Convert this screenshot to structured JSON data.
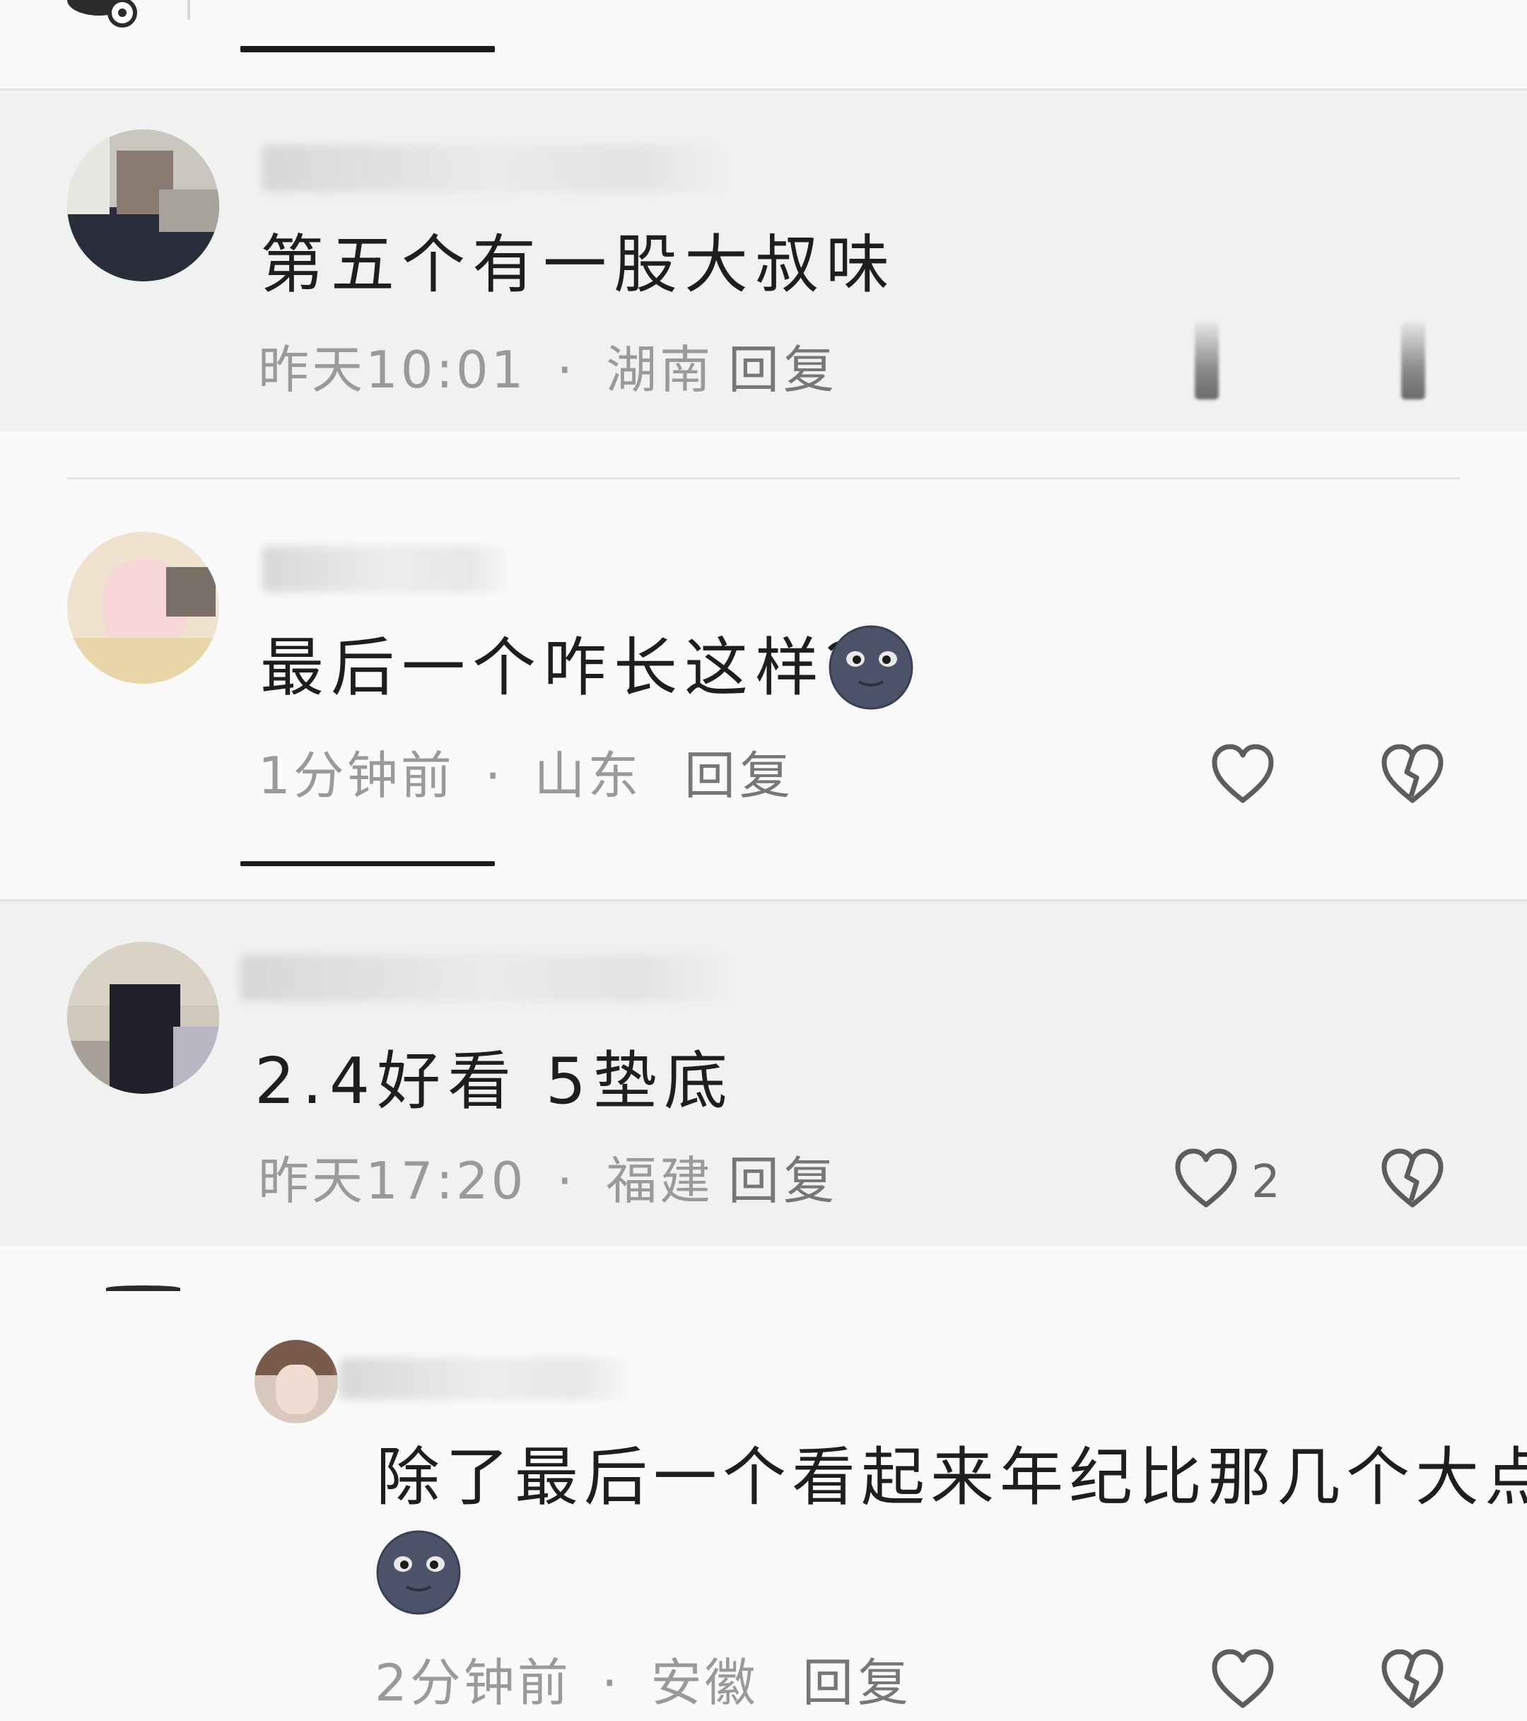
{
  "comments": [
    {
      "text": "第五个有一股大叔味",
      "time": "昨天10:01",
      "location": "湖南",
      "reply_label": "回复"
    },
    {
      "text": "最后一个咋长这样？",
      "time": "1分钟前",
      "location": "山东",
      "reply_label": "回复",
      "emoji": "moon-face-emoji"
    },
    {
      "text": "2.4好看 5垫底",
      "time": "昨天17:20",
      "location": "福建",
      "reply_label": "回复",
      "like_count": "2"
    }
  ],
  "reply": {
    "text": "除了最后一个看起来年纪比那几个大点",
    "time": "2分钟前",
    "location": "安徽",
    "reply_label": "回复",
    "emoji": "moon-face-emoji"
  },
  "separator": "·",
  "icons": {
    "like": "heart-outline-icon",
    "dislike": "broken-heart-icon"
  }
}
